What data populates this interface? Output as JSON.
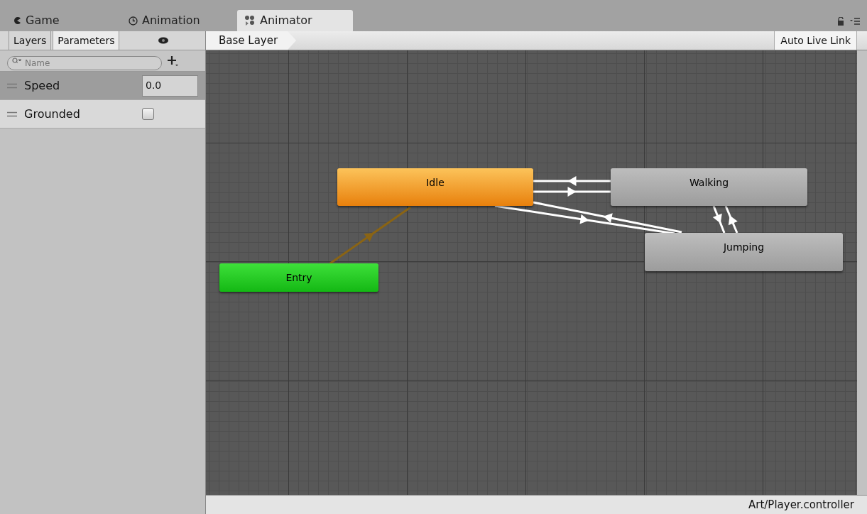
{
  "window_tabs": [
    {
      "label": "Game",
      "kind": "game",
      "selected": false
    },
    {
      "label": "Animation",
      "kind": "animation",
      "selected": false
    },
    {
      "label": "Animator",
      "kind": "animator",
      "selected": true
    }
  ],
  "sidebar": {
    "tabs": [
      {
        "label": "Layers",
        "selected": false
      },
      {
        "label": "Parameters",
        "selected": true
      }
    ],
    "search": {
      "placeholder": "Name"
    },
    "parameters": [
      {
        "name": "Speed",
        "kind": "float",
        "value": "0.0",
        "selected": true
      },
      {
        "name": "Grounded",
        "kind": "bool",
        "checked": false,
        "selected": false
      }
    ]
  },
  "toolbar": {
    "breadcrumb": "Base Layer",
    "button": "Auto Live Link"
  },
  "graph": {
    "nodes": [
      {
        "label": "Idle",
        "kind": "default"
      },
      {
        "label": "Walking",
        "kind": "state"
      },
      {
        "label": "Jumping",
        "kind": "state"
      },
      {
        "label": "Entry",
        "kind": "entry"
      }
    ]
  },
  "status_bar": "Art/Player.controller"
}
